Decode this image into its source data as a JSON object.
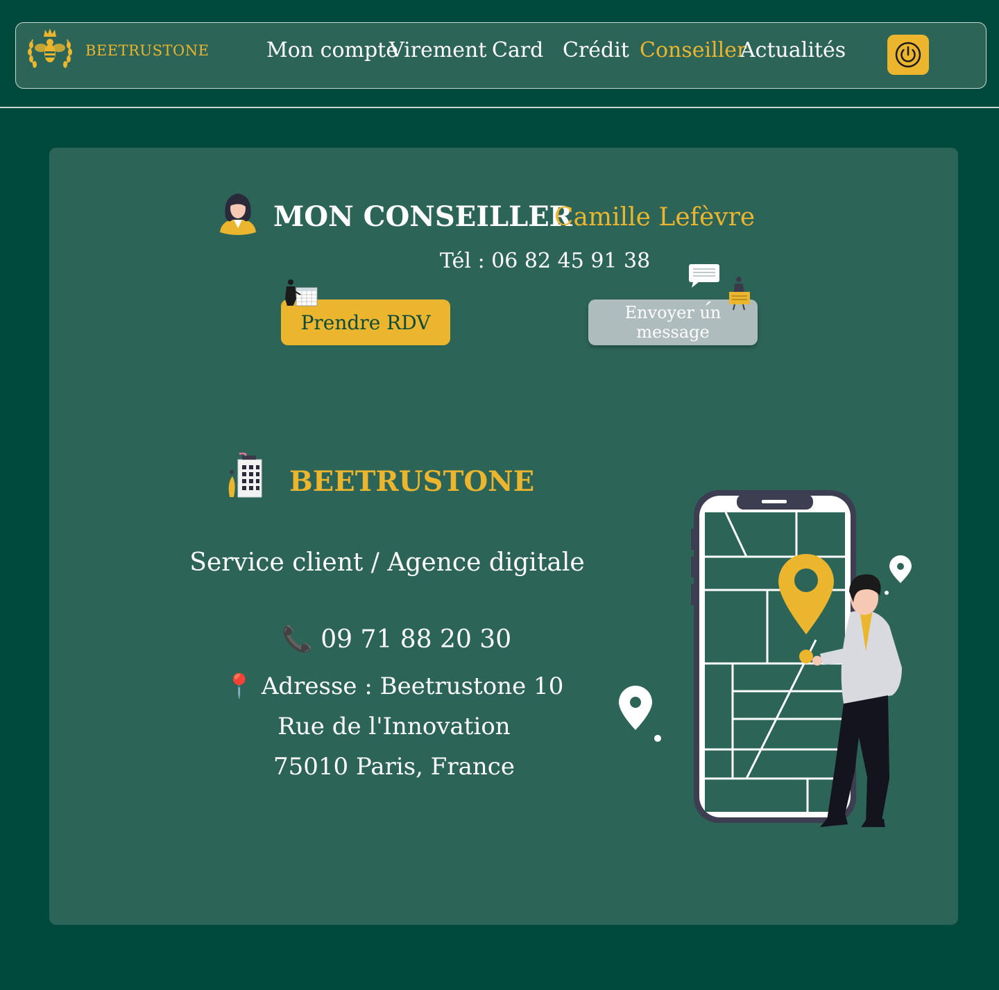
{
  "header": {
    "brand": "BEETRUSTONE",
    "nav": [
      {
        "label": "Mon compte",
        "active": false
      },
      {
        "label": "Virement",
        "active": false
      },
      {
        "label": "Card",
        "active": false
      },
      {
        "label": "Crédit",
        "active": false
      },
      {
        "label": "Conseiller",
        "active": true
      },
      {
        "label": "Actualités",
        "active": false
      }
    ],
    "logout_icon": "power-icon"
  },
  "advisor": {
    "title": "MON CONSEILLER",
    "name": "Camille Lefèvre",
    "phone": "Tél : 06 82 45 91 38",
    "rdv_button": "Prendre RDV",
    "message_button": "Envoyer un message"
  },
  "agency": {
    "name": "BEETRUSTONE",
    "service": "Service client / Agence digitale",
    "phone": "09 71 88 20 30",
    "phone_icon": "📞",
    "address_icon": "📍",
    "address_line1": "Adresse : Beetrustone 10 Rue de l'Innovation",
    "address_line2": "75010 Paris, France"
  },
  "colors": {
    "background": "#004a3d",
    "panel": "#2d6458",
    "accent": "#ebb52d",
    "text": "#ffffff",
    "secondary_button": "#aebcbd"
  }
}
